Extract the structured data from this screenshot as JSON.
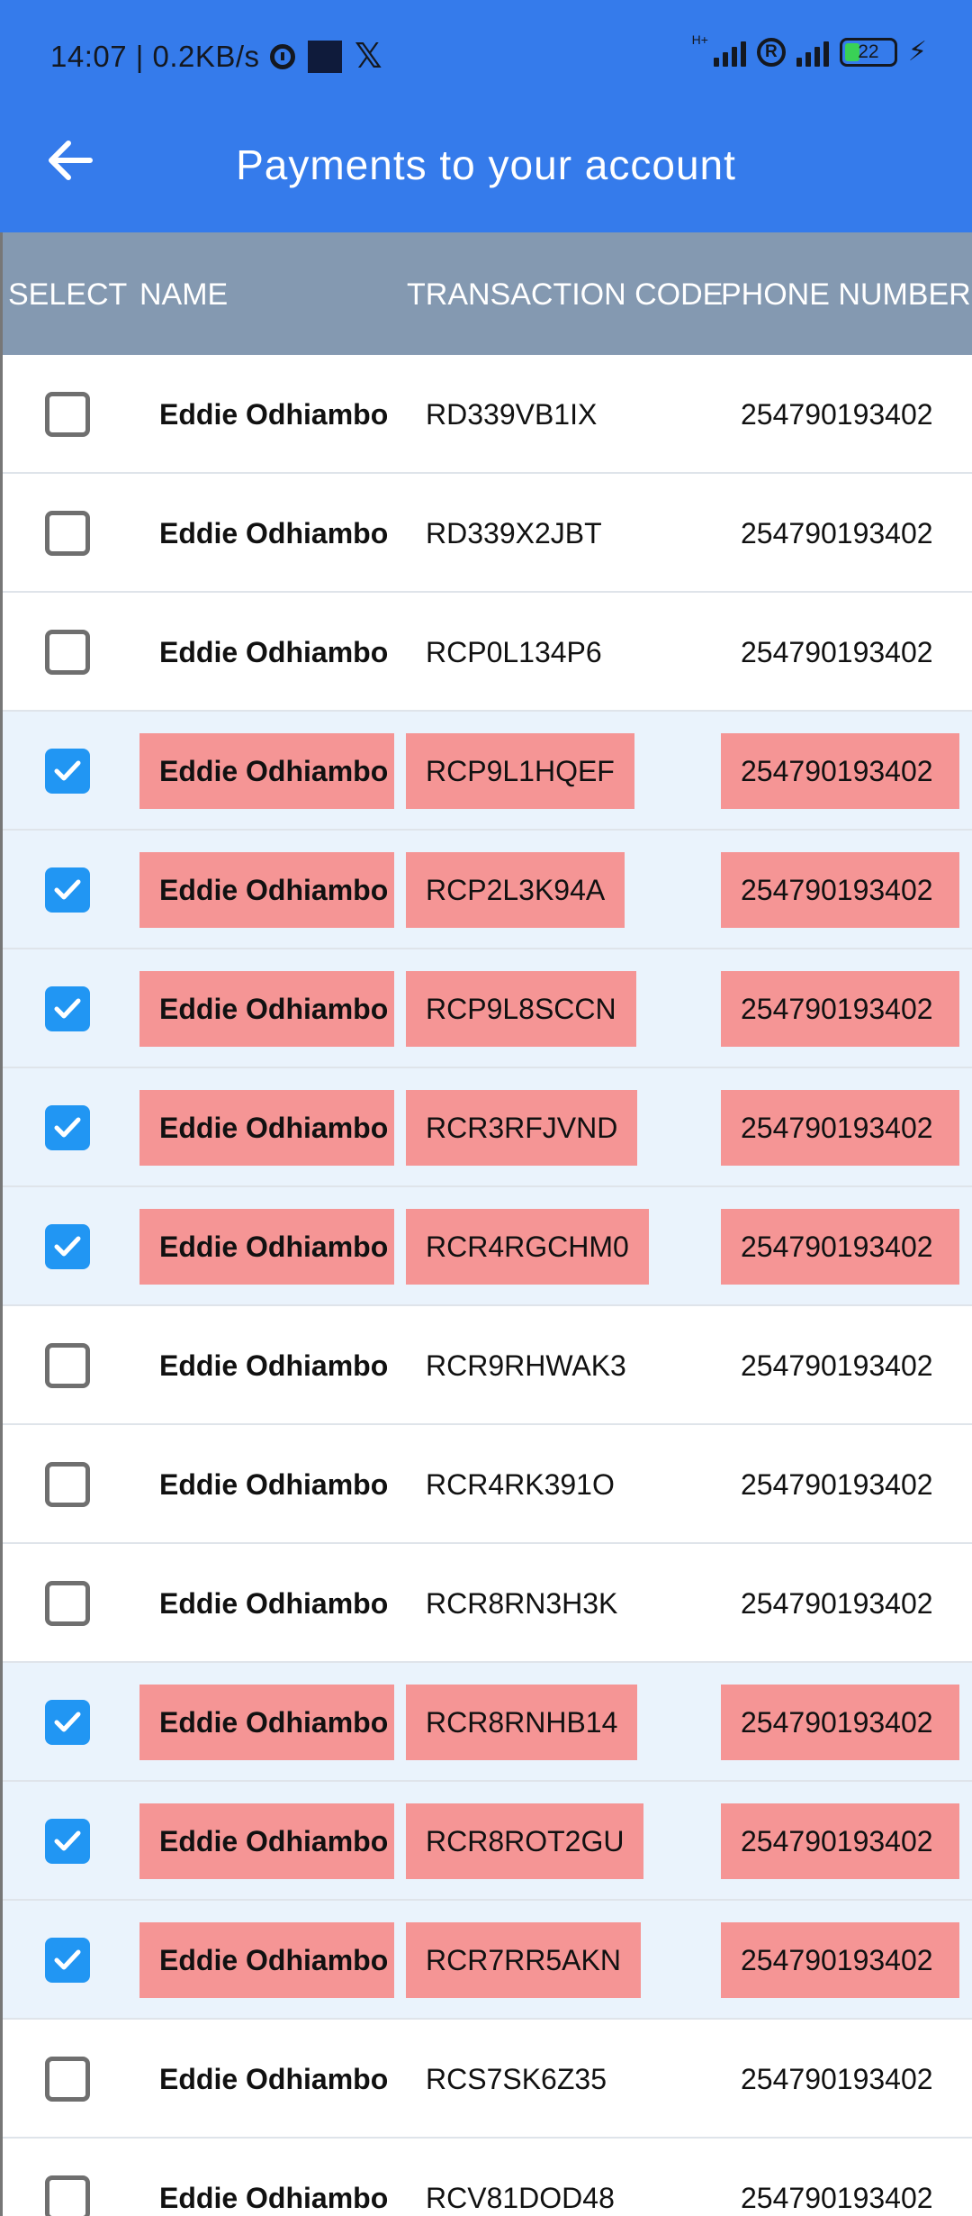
{
  "status_bar": {
    "time": "14:07 | 0.2KB/s",
    "network_type": "H+",
    "roaming_icon_letter": "R",
    "battery": "22"
  },
  "header": {
    "title": "Payments to your account"
  },
  "table": {
    "columns": {
      "select": "SELECT",
      "name": "NAME",
      "code": "TRANSACTION CODE",
      "phone": "PHONE NUMBER"
    },
    "rows": [
      {
        "name": "Eddie Odhiambo",
        "code": "RD339VB1IX",
        "phone": "254790193402",
        "selected": false
      },
      {
        "name": "Eddie Odhiambo",
        "code": "RD339X2JBT",
        "phone": "254790193402",
        "selected": false
      },
      {
        "name": "Eddie Odhiambo",
        "code": "RCP0L134P6",
        "phone": "254790193402",
        "selected": false
      },
      {
        "name": "Eddie Odhiambo",
        "code": "RCP9L1HQEF",
        "phone": "254790193402",
        "selected": true
      },
      {
        "name": "Eddie Odhiambo",
        "code": "RCP2L3K94A",
        "phone": "254790193402",
        "selected": true
      },
      {
        "name": "Eddie Odhiambo",
        "code": "RCP9L8SCCN",
        "phone": "254790193402",
        "selected": true
      },
      {
        "name": "Eddie Odhiambo",
        "code": "RCR3RFJVND",
        "phone": "254790193402",
        "selected": true
      },
      {
        "name": "Eddie Odhiambo",
        "code": "RCR4RGCHM0",
        "phone": "254790193402",
        "selected": true
      },
      {
        "name": "Eddie Odhiambo",
        "code": "RCR9RHWAK3",
        "phone": "254790193402",
        "selected": false
      },
      {
        "name": "Eddie Odhiambo",
        "code": "RCR4RK391O",
        "phone": "254790193402",
        "selected": false
      },
      {
        "name": "Eddie Odhiambo",
        "code": "RCR8RN3H3K",
        "phone": "254790193402",
        "selected": false
      },
      {
        "name": "Eddie Odhiambo",
        "code": "RCR8RNHB14",
        "phone": "254790193402",
        "selected": true
      },
      {
        "name": "Eddie Odhiambo",
        "code": "RCR8ROT2GU",
        "phone": "254790193402",
        "selected": true
      },
      {
        "name": "Eddie Odhiambo",
        "code": "RCR7RR5AKN",
        "phone": "254790193402",
        "selected": true
      },
      {
        "name": "Eddie Odhiambo",
        "code": "RCS7SK6Z35",
        "phone": "254790193402",
        "selected": false
      },
      {
        "name": "Eddie Odhiambo",
        "code": "RCV81DOD48",
        "phone": "254790193402",
        "selected": false
      }
    ]
  },
  "colors": {
    "app_bar": "#357BEB",
    "table_header": "#8499B1",
    "selected_row": "#EAF3FC",
    "selected_cell": "#F59595",
    "checkbox_checked": "#2196F3"
  }
}
